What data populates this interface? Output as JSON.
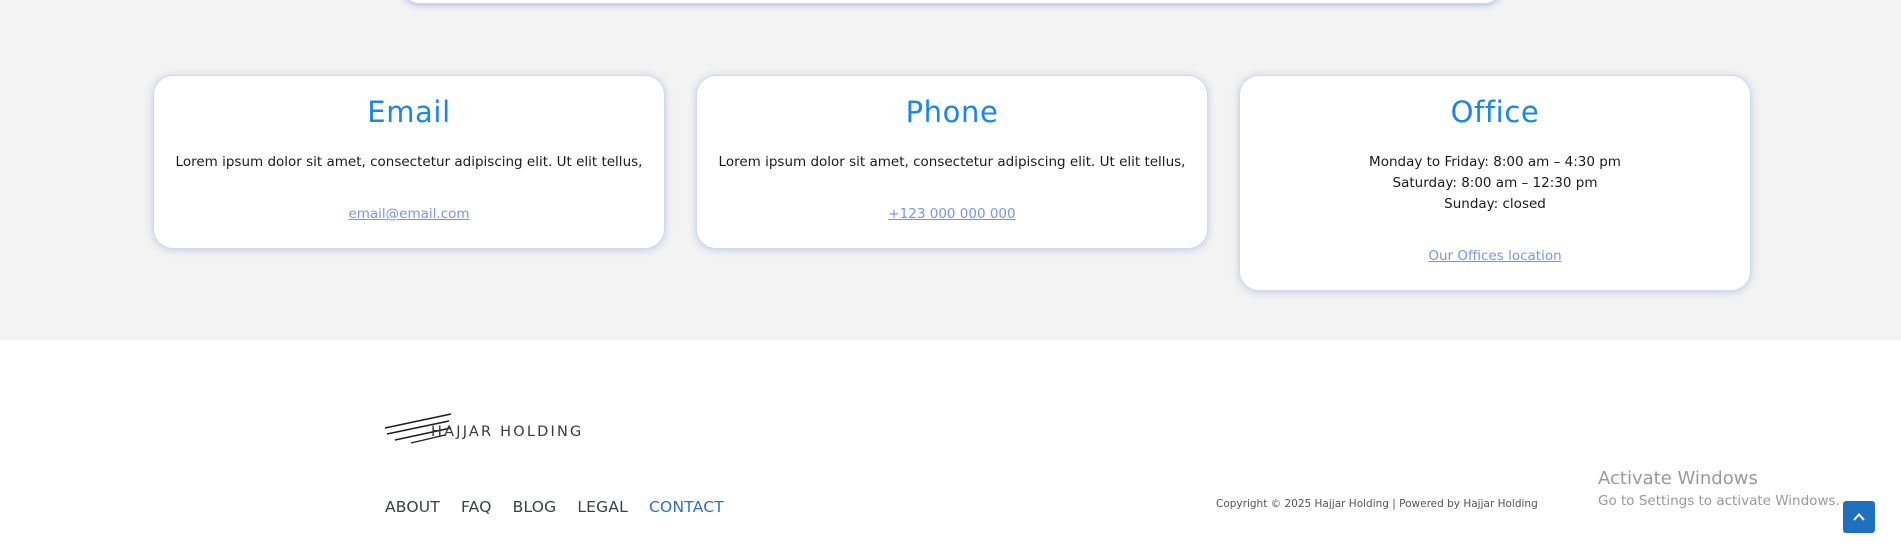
{
  "contact_cards": {
    "email": {
      "title": "Email",
      "text": "Lorem ipsum dolor sit amet, consectetur adipiscing elit. Ut elit tellus,",
      "link": "email@email.com"
    },
    "phone": {
      "title": "Phone",
      "text": "Lorem ipsum dolor sit amet, consectetur adipiscing elit. Ut elit tellus,",
      "link": "+123 000 000 000"
    },
    "office": {
      "title": "Office",
      "hours": [
        "Monday to Friday: 8:00 am – 4:30 pm",
        "Saturday: 8:00 am – 12:30 pm",
        "Sunday: closed"
      ],
      "link": "Our Offices location"
    }
  },
  "footer": {
    "logo_text": "HAJJAR HOLDING",
    "nav": [
      "ABOUT",
      "FAQ",
      "BLOG",
      "LEGAL",
      "CONTACT"
    ],
    "active_nav": "CONTACT",
    "copyright": "Copyright © 2025 Hajjar Holding | Powered by Hajjar Holding"
  },
  "windows_watermark": {
    "title": "Activate Windows",
    "subtitle": "Go to Settings to activate Windows."
  },
  "colors": {
    "accent": "#1986e8",
    "link": "#7c95e6",
    "scroll_button": "#1f6fbf",
    "section_background": "#f3f3f3"
  },
  "icons": {
    "scroll_top": "chevron-up-icon",
    "logo": "hajjar-logo-mark"
  }
}
